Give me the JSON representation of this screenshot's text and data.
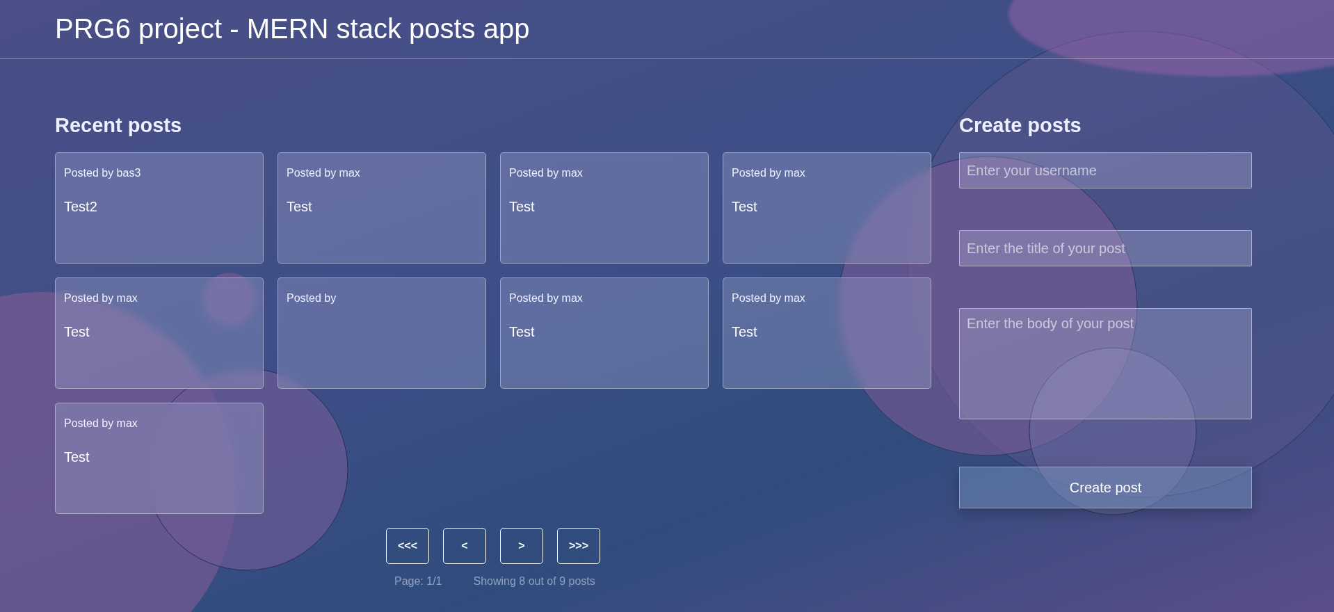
{
  "header": {
    "title": "PRG6 project - MERN stack posts app"
  },
  "recent": {
    "heading": "Recent posts",
    "posts": [
      {
        "byline": "Posted by bas3",
        "title": "Test2"
      },
      {
        "byline": "Posted by max",
        "title": "Test"
      },
      {
        "byline": "Posted by max",
        "title": "Test"
      },
      {
        "byline": "Posted by max",
        "title": "Test"
      },
      {
        "byline": "Posted by max",
        "title": "Test"
      },
      {
        "byline": "Posted by"
      },
      {
        "byline": "Posted by max",
        "title": "Test"
      },
      {
        "byline": "Posted by max",
        "title": "Test"
      },
      {
        "byline": "Posted by max",
        "title": "Test"
      }
    ],
    "pagination": {
      "buttons": [
        "<<<",
        "<",
        ">",
        ">>>"
      ],
      "page": "Page: 1/1",
      "showing": "Showing 8 out of 9 posts"
    }
  },
  "create": {
    "heading": "Create posts",
    "fields": [
      {
        "kind": "input",
        "placeholder": "Enter your username"
      },
      {
        "kind": "input",
        "placeholder": "Enter the title of your post"
      },
      {
        "kind": "textarea",
        "placeholder": "Enter the body of your post"
      }
    ],
    "submit": "Create post"
  }
}
